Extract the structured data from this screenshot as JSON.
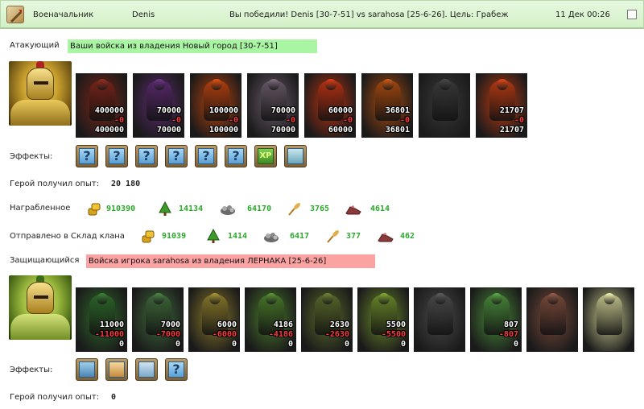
{
  "header": {
    "title": "Военачальник",
    "player": "Denis",
    "result": "Вы победили! Denis [30-7-51] vs sarahosa [25-6-26]. Цель: Грабеж",
    "datetime": "11 Дек 00:26"
  },
  "attacker": {
    "label": "Атакующий",
    "banner": "Ваши войска из владения Новый город [30-7-51]",
    "units": [
      {
        "start": "400000",
        "loss": "-0",
        "end": "400000",
        "color": "#7a2418"
      },
      {
        "start": "70000",
        "loss": "-0",
        "end": "70000",
        "color": "#5a2a6e"
      },
      {
        "start": "100000",
        "loss": "-0",
        "end": "100000",
        "color": "#b8420e"
      },
      {
        "start": "70000",
        "loss": "-0",
        "end": "70000",
        "color": "#6a5a6a"
      },
      {
        "start": "60000",
        "loss": "-0",
        "end": "60000",
        "color": "#b83212"
      },
      {
        "start": "36801",
        "loss": "-0",
        "end": "36801",
        "color": "#a84a10"
      },
      {
        "start": "",
        "loss": "",
        "end": "",
        "color": "#3a3a3a"
      },
      {
        "start": "21707",
        "loss": "-0",
        "end": "21707",
        "color": "#b83a12"
      }
    ],
    "effects_label": "Эффекты:",
    "effects": [
      "?",
      "?",
      "?",
      "?",
      "?",
      "?",
      "XP",
      ""
    ],
    "hero_exp_label": "Герой получил опыт:",
    "hero_exp": "20 180"
  },
  "loot": {
    "label": "Награбленное",
    "values": [
      "910390",
      "14134",
      "64170",
      "3765",
      "4614"
    ],
    "icons": [
      "gold-icon",
      "wood-icon",
      "stone-icon",
      "grain-icon",
      "ore-icon"
    ]
  },
  "clan": {
    "label": "Отправлено в Склад клана",
    "values": [
      "91039",
      "1414",
      "6417",
      "377",
      "462"
    ]
  },
  "defender": {
    "label": "Защищающийся",
    "banner": "Войска игрока sarahosa из владения ЛЕРНАКА [25-6-26]",
    "units": [
      {
        "start": "11000",
        "loss": "-11000",
        "end": "0",
        "color": "#2e6a2a"
      },
      {
        "start": "7000",
        "loss": "-7000",
        "end": "0",
        "color": "#3f6a3a"
      },
      {
        "start": "6000",
        "loss": "-6000",
        "end": "0",
        "color": "#8a7a2a"
      },
      {
        "start": "4186",
        "loss": "-4186",
        "end": "0",
        "color": "#4a7a2a"
      },
      {
        "start": "2630",
        "loss": "-2630",
        "end": "0",
        "color": "#5a6a2a"
      },
      {
        "start": "5500",
        "loss": "-5500",
        "end": "0",
        "color": "#6a8a2a"
      },
      {
        "start": "",
        "loss": "",
        "end": "",
        "color": "#4a4a4a"
      },
      {
        "start": "807",
        "loss": "-807",
        "end": "0",
        "color": "#4a8a3a"
      },
      {
        "start": "",
        "loss": "",
        "end": "",
        "color": "#7a4a3a"
      },
      {
        "start": "",
        "loss": "",
        "end": "",
        "color": "#c8c890"
      }
    ],
    "effects_label": "Эффекты:",
    "effects": [
      "",
      "",
      "",
      "?"
    ],
    "hero_exp_label": "Герой получил опыт:",
    "hero_exp": "0"
  },
  "colors": {
    "accent_green": "#2aa82a",
    "loss_red": "#ff3b3b",
    "banner_green": "#a9f5a3",
    "banner_red": "#fba3a3"
  }
}
